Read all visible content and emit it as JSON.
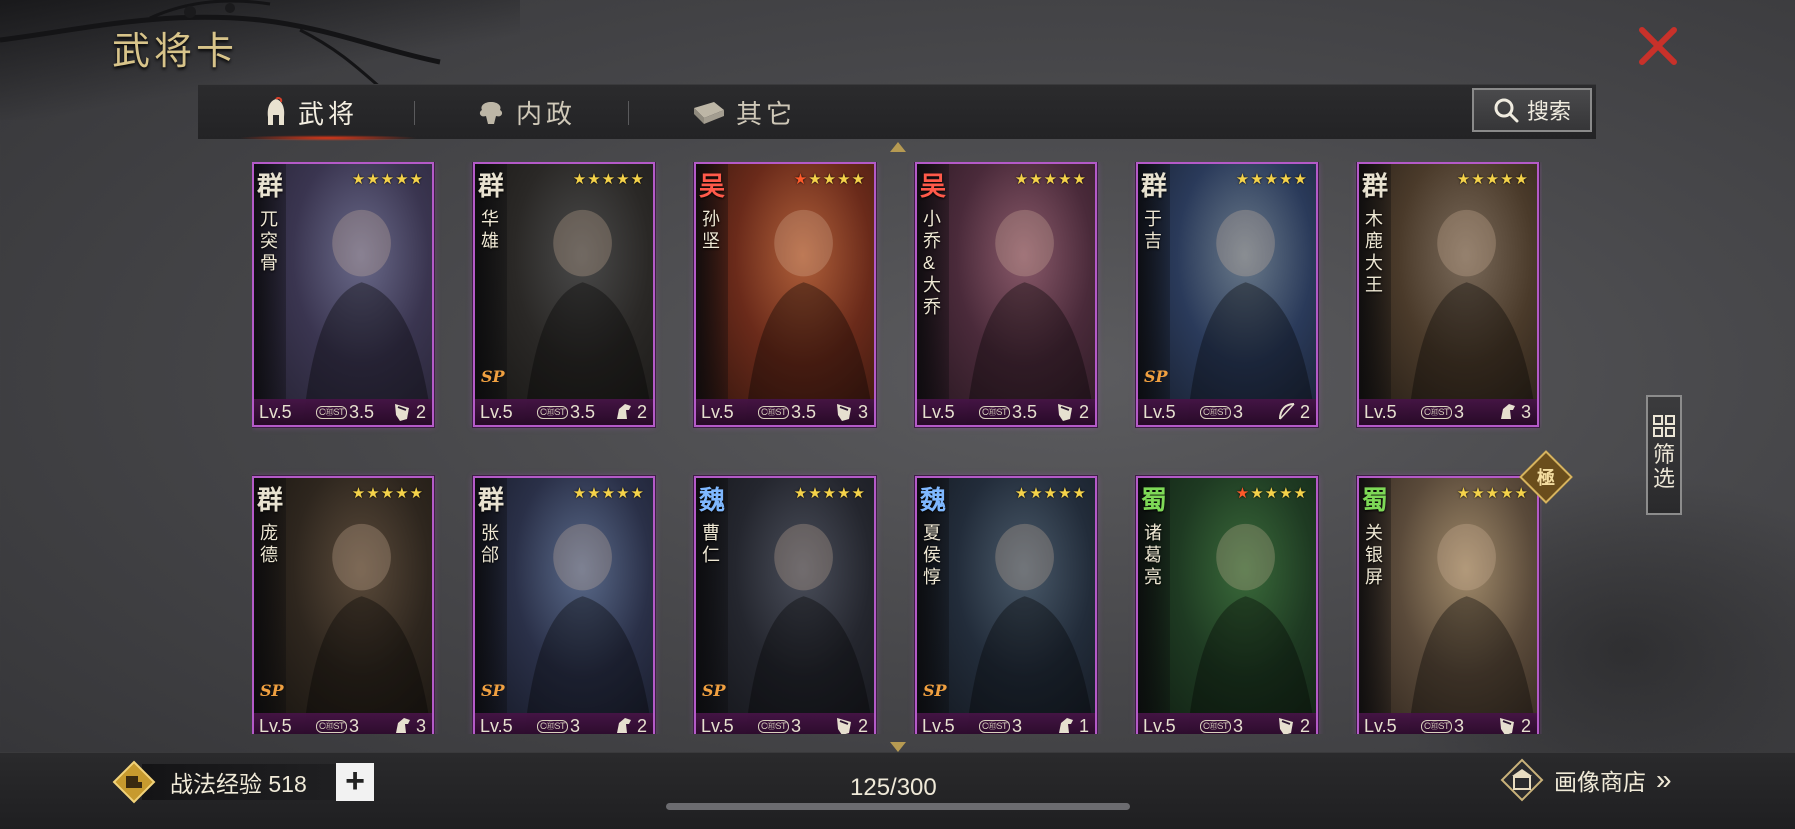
{
  "title": "武将卡",
  "tabs": [
    {
      "label": "武将",
      "icon": "helmet-icon",
      "active": true
    },
    {
      "label": "内政",
      "icon": "tree-icon",
      "active": false
    },
    {
      "label": "其它",
      "icon": "scroll-icon",
      "active": false
    }
  ],
  "search_label": "搜索",
  "filter_label": "筛选",
  "cards": [
    {
      "faction": "群",
      "name": "兀突骨",
      "stars": 5,
      "red_stars": 0,
      "level": "Lv.5",
      "cost": "3.5",
      "unit": "shield",
      "unit_count": "2",
      "sp": false
    },
    {
      "faction": "群",
      "name": "华雄",
      "stars": 5,
      "red_stars": 0,
      "level": "Lv.5",
      "cost": "3.5",
      "unit": "horse",
      "unit_count": "2",
      "sp": true
    },
    {
      "faction": "吴",
      "name": "孙坚",
      "stars": 5,
      "red_stars": 1,
      "level": "Lv.5",
      "cost": "3.5",
      "unit": "shield",
      "unit_count": "3",
      "sp": false
    },
    {
      "faction": "吴",
      "name": "小乔&大乔",
      "stars": 5,
      "red_stars": 0,
      "level": "Lv.5",
      "cost": "3.5",
      "unit": "shield",
      "unit_count": "2",
      "sp": false
    },
    {
      "faction": "群",
      "name": "于吉",
      "stars": 5,
      "red_stars": 0,
      "level": "Lv.5",
      "cost": "3",
      "unit": "bow",
      "unit_count": "2",
      "sp": true
    },
    {
      "faction": "群",
      "name": "木鹿大王",
      "stars": 5,
      "red_stars": 0,
      "level": "Lv.5",
      "cost": "3",
      "unit": "horse",
      "unit_count": "3",
      "sp": false
    },
    {
      "faction": "群",
      "name": "庞德",
      "stars": 5,
      "red_stars": 0,
      "level": "Lv.5",
      "cost": "3",
      "unit": "horse",
      "unit_count": "3",
      "sp": true
    },
    {
      "faction": "群",
      "name": "张郃",
      "stars": 5,
      "red_stars": 0,
      "level": "Lv.5",
      "cost": "3",
      "unit": "horse",
      "unit_count": "2",
      "sp": true
    },
    {
      "faction": "魏",
      "name": "曹仁",
      "stars": 5,
      "red_stars": 0,
      "level": "Lv.5",
      "cost": "3",
      "unit": "shield",
      "unit_count": "2",
      "sp": true
    },
    {
      "faction": "魏",
      "name": "夏侯惇",
      "stars": 5,
      "red_stars": 0,
      "level": "Lv.5",
      "cost": "3",
      "unit": "horse",
      "unit_count": "1",
      "sp": true
    },
    {
      "faction": "蜀",
      "name": "诸葛亮",
      "stars": 5,
      "red_stars": 1,
      "level": "Lv.5",
      "cost": "3",
      "unit": "shield",
      "unit_count": "2",
      "sp": false
    },
    {
      "faction": "蜀",
      "name": "关银屏",
      "stars": 5,
      "red_stars": 0,
      "level": "Lv.5",
      "cost": "3",
      "unit": "shield",
      "unit_count": "2",
      "sp": false
    }
  ],
  "ultimate_badge": "極",
  "cost_tag": "C㊞ST",
  "sp_tag": "SP",
  "exp_label": "战法经验 518",
  "plus_label": "+",
  "card_count": "125/300",
  "shop_label": "画像商店",
  "shop_arrow": "»",
  "faction_colors": {
    "群": "#e8e2d0",
    "吴": "#ff5a4a",
    "魏": "#7fb8ff",
    "蜀": "#7ed957"
  },
  "accent_color": "#b45ac8"
}
